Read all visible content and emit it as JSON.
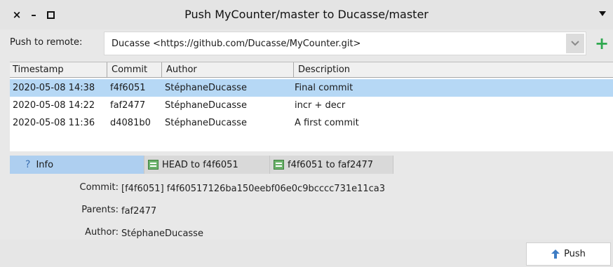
{
  "window": {
    "title": "Push MyCounter/master to Ducasse/master",
    "controls": {
      "close": "×",
      "minimize": "–"
    }
  },
  "remote": {
    "label": "Push to remote:",
    "value": "Ducasse <https://github.com/Ducasse/MyCounter.git>",
    "add_icon": "+"
  },
  "table": {
    "columns": [
      "Timestamp",
      "Commit",
      "Author",
      "Description"
    ],
    "rows": [
      {
        "timestamp": "2020-05-08 14:38",
        "commit": "f4f6051",
        "author": "StéphaneDucasse",
        "description": "Final commit"
      },
      {
        "timestamp": "2020-05-08 14:22",
        "commit": "faf2477",
        "author": "StéphaneDucasse",
        "description": "incr + decr"
      },
      {
        "timestamp": "2020-05-08 11:36",
        "commit": "d4081b0",
        "author": "StéphaneDucasse",
        "description": "A first commit"
      }
    ]
  },
  "tabs": [
    {
      "label": "Info",
      "icon": "?"
    },
    {
      "label": "HEAD to f4f6051"
    },
    {
      "label": "f4f6051 to faf2477"
    }
  ],
  "info": {
    "commit_key": "Commit:",
    "commit_value": "[f4f6051] f4f60517126ba150eebf06e0c9bcccc731e11ca3",
    "parents_key": "Parents:",
    "parents_value": "faf2477",
    "author_key": "Author:",
    "author_value": "StéphaneDucasse"
  },
  "actions": {
    "push_label": "Push"
  },
  "colors": {
    "selection": "#b6d8f5",
    "active_tab": "#aecff0",
    "add_green": "#2fa84f",
    "push_arrow": "#3d7cc4"
  }
}
